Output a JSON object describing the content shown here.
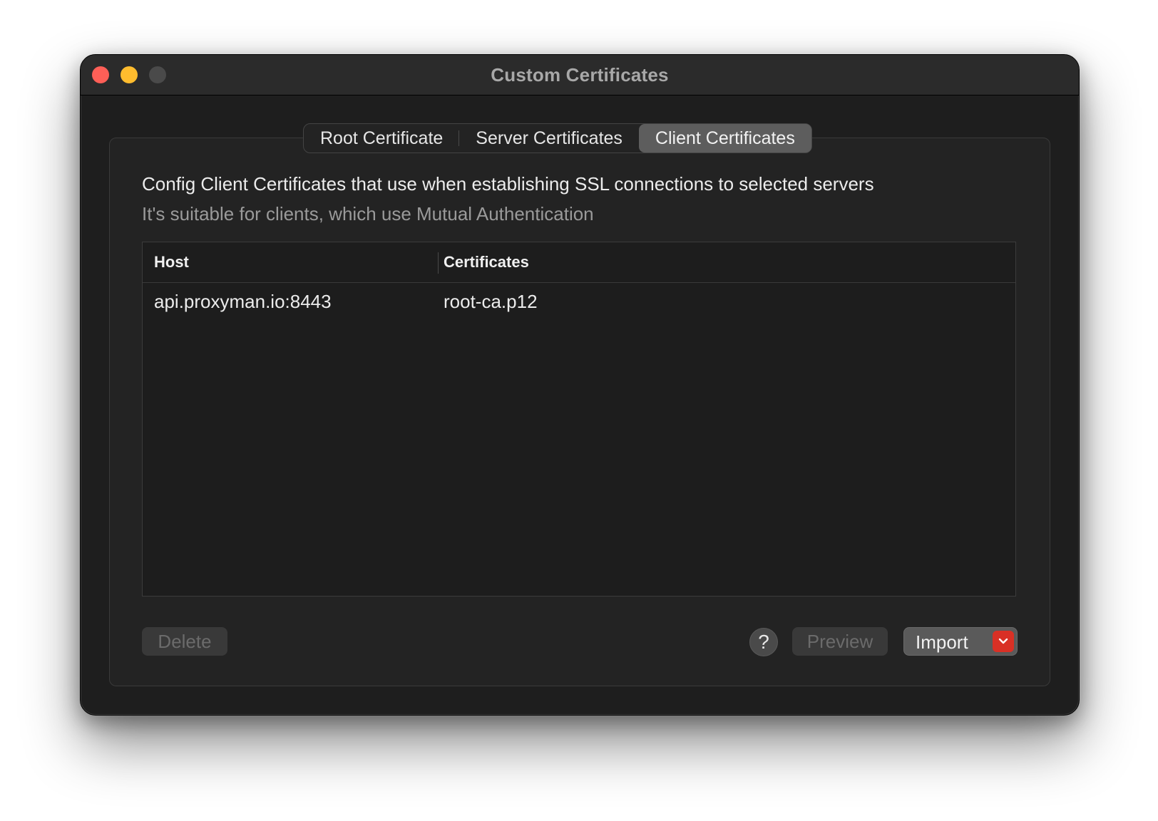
{
  "window": {
    "title": "Custom Certificates"
  },
  "tabs": [
    {
      "label": "Root Certificate",
      "active": false
    },
    {
      "label": "Server Certificates",
      "active": false
    },
    {
      "label": "Client Certificates",
      "active": true
    }
  ],
  "description": {
    "primary": "Config Client Certificates that use when establishing SSL connections to selected servers",
    "secondary": "It's suitable for clients, which use Mutual Authentication"
  },
  "table": {
    "columns": [
      "Host",
      "Certificates"
    ],
    "rows": [
      {
        "host": "api.proxyman.io:8443",
        "certificate": "root-ca.p12"
      }
    ]
  },
  "buttons": {
    "delete": "Delete",
    "help": "?",
    "preview": "Preview",
    "import": "Import"
  },
  "icons": {
    "close": "close-icon",
    "minimize": "minimize-icon",
    "zoom": "zoom-icon",
    "import_dropdown": "chevron-down-icon"
  },
  "colors": {
    "close": "#fe5f57",
    "minimize": "#febc2e",
    "accent_dropdown": "#d93025"
  }
}
